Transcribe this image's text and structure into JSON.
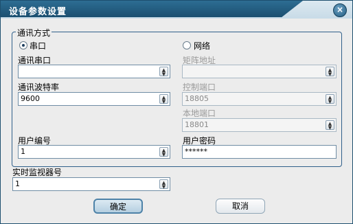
{
  "window": {
    "title": "设备参数设置",
    "close_symbol": "×"
  },
  "comm": {
    "group_label": "通讯方式",
    "radio_serial": "串口",
    "radio_network": "网络",
    "serial_port_label": "通讯串口",
    "serial_port_value": "",
    "baud_label": "通讯波特率",
    "baud_value": "9600",
    "matrix_addr_label": "矩阵地址",
    "matrix_addr_value": "",
    "ctrl_port_label": "控制端口",
    "ctrl_port_value": "18805",
    "local_port_label": "本地端口",
    "local_port_value": "18801",
    "user_no_label": "用户编号",
    "user_no_value": "1",
    "password_label": "用户密码",
    "password_value": "******"
  },
  "monitor": {
    "label": "实时监视器号",
    "value": "1"
  },
  "buttons": {
    "ok": "确定",
    "cancel": "取消"
  },
  "colors": {
    "title_bar": "#1b4f70",
    "accent": "#2f5f8a",
    "window_bg": "#ececec"
  }
}
